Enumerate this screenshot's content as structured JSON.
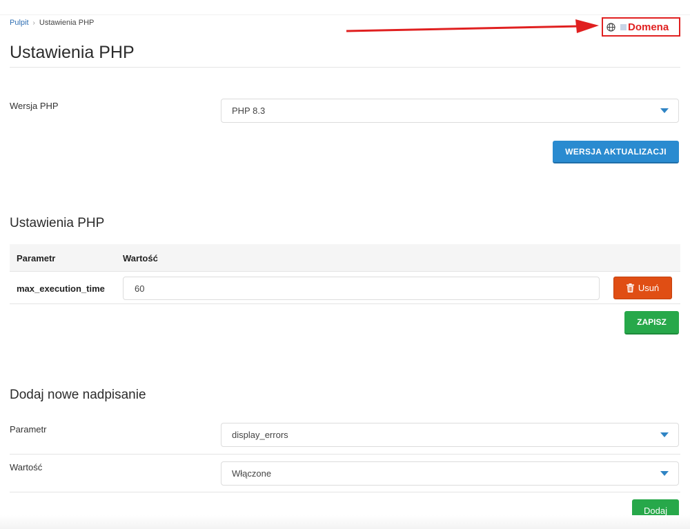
{
  "breadcrumb": {
    "home": "Pulpit",
    "current": "Ustawienia PHP"
  },
  "domain": {
    "label": "Domena"
  },
  "page_title": "Ustawienia PHP",
  "php_version": {
    "label": "Wersja PHP",
    "selected": "PHP 8.3",
    "update_button": "WERSJA AKTUALIZACJI"
  },
  "settings": {
    "title": "Ustawienia PHP",
    "columns": [
      "Parametr",
      "Wartość"
    ],
    "rows": [
      {
        "name": "max_execution_time",
        "value": "60",
        "delete_label": "Usuń"
      }
    ],
    "save_button": "ZAPISZ"
  },
  "add_override": {
    "title": "Dodaj nowe nadpisanie",
    "param_label": "Parametr",
    "param_selected": "display_errors",
    "value_label": "Wartość",
    "value_selected": "Włączone",
    "add_button": "Dodaj"
  },
  "colors": {
    "annotation": "#e02020",
    "primary": "#2a8bd0",
    "success": "#27a84a",
    "danger": "#e04e14"
  }
}
